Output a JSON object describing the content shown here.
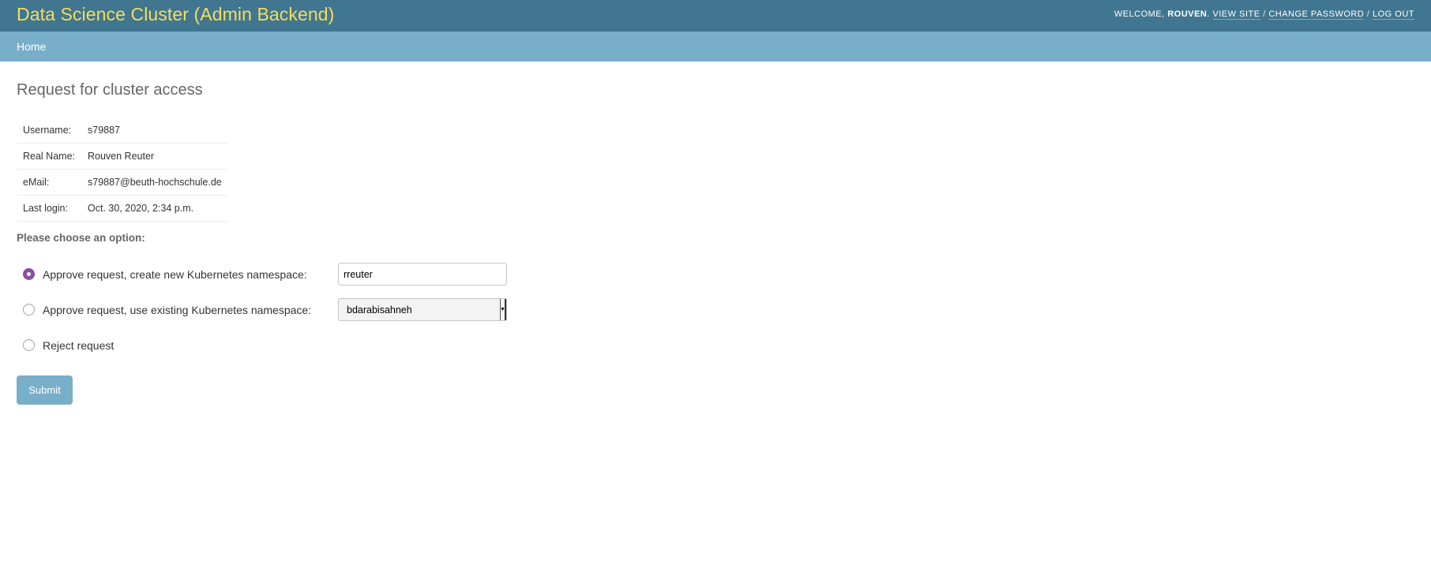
{
  "header": {
    "title": "Data Science Cluster (Admin Backend)",
    "welcome_text": "Welcome,",
    "user_name": "Rouven",
    "view_site": "View site",
    "change_password": "Change password",
    "log_out": "Log out",
    "separator": "/"
  },
  "breadcrumbs": {
    "home": "Home"
  },
  "page": {
    "title": "Request for cluster access"
  },
  "user_info": [
    {
      "label": "Username:",
      "value": "s79887"
    },
    {
      "label": "Real Name:",
      "value": "Rouven Reuter"
    },
    {
      "label": "eMail:",
      "value": "s79887@beuth-hochschule.de"
    },
    {
      "label": "Last login:",
      "value": "Oct. 30, 2020, 2:34 p.m."
    }
  ],
  "options": {
    "heading": "Please choose an option:",
    "approve_new_label": "Approve request, create new Kubernetes namespace:",
    "approve_new_value": "rreuter",
    "approve_existing_label": "Approve request, use existing Kubernetes namespace:",
    "approve_existing_selected": "bdarabisahneh",
    "reject_label": "Reject request",
    "selected": "approve_new"
  },
  "submit_label": "Submit",
  "colors": {
    "header_bg": "#417690",
    "branding": "#f5dd5d",
    "breadcrumbs_bg": "#79aec8",
    "radio_checked": "#8b4e9e"
  }
}
